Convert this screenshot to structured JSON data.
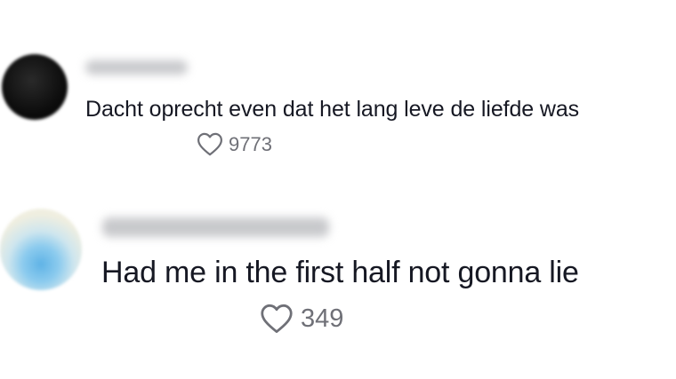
{
  "comments": [
    {
      "username": "",
      "text": "Dacht oprecht even dat het lang leve de liefde was",
      "likes": "9773"
    },
    {
      "username": "",
      "text": "Had me in the first half not gonna lie",
      "likes": "349"
    }
  ],
  "icons": {
    "like": "heart-outline-icon"
  },
  "colors": {
    "text": "#161823",
    "muted": "#6f7077",
    "background": "#ffffff"
  }
}
